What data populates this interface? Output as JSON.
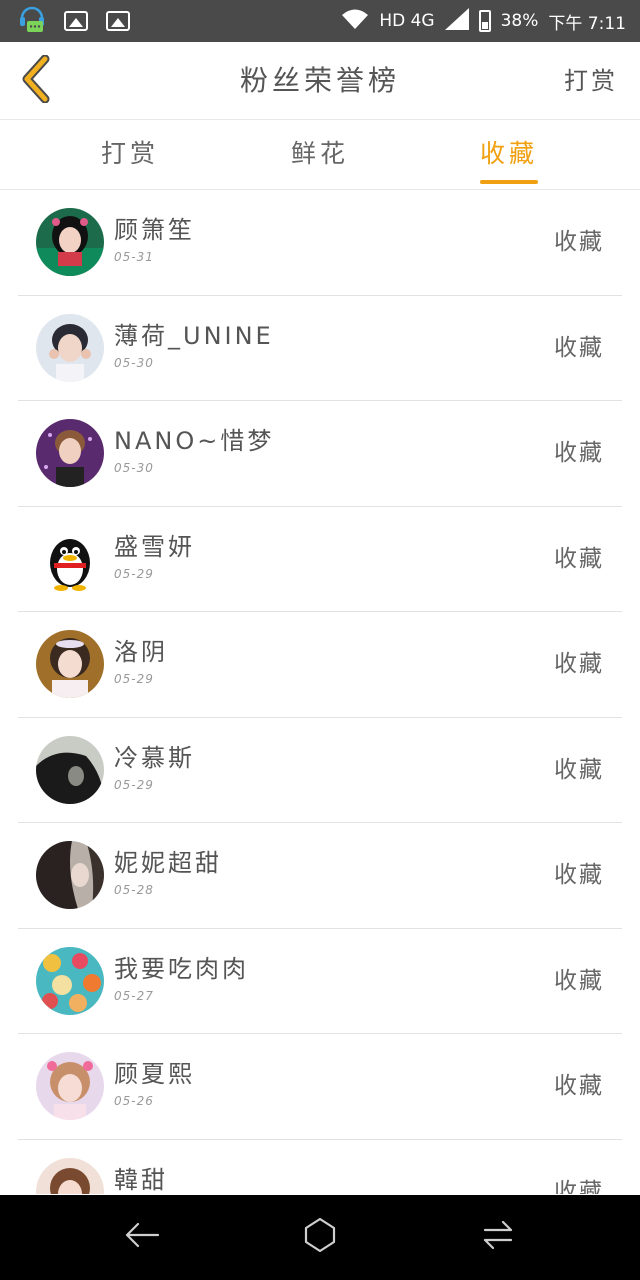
{
  "status_bar": {
    "network": "HD 4G",
    "battery": "38%",
    "time": "下午 7:11",
    "icons": [
      "headset-chat-icon",
      "image-icon",
      "image-icon",
      "wifi-icon",
      "signal-icon",
      "battery-icon"
    ]
  },
  "header": {
    "title": "粉丝荣誉榜",
    "action_label": "打赏",
    "back_icon": "chevron-left-icon"
  },
  "tabs": [
    {
      "label": "打赏",
      "active": false
    },
    {
      "label": "鲜花",
      "active": false
    },
    {
      "label": "收藏",
      "active": true
    }
  ],
  "colors": {
    "accent": "#f0a010",
    "back_icon": "#f0b020",
    "text": "#555555",
    "divider": "#e2e2e2",
    "status_bar": "#4a4a4a",
    "nav_bar": "#000000"
  },
  "list": [
    {
      "name": "顾箫笙",
      "date": "05-31",
      "action": "收藏"
    },
    {
      "name": "薄荷_UNINE",
      "date": "05-30",
      "action": "收藏"
    },
    {
      "name": "NANO~惜梦",
      "date": "05-30",
      "action": "收藏"
    },
    {
      "name": "盛雪妍",
      "date": "05-29",
      "action": "收藏"
    },
    {
      "name": "洛阴",
      "date": "05-29",
      "action": "收藏"
    },
    {
      "name": "冷慕斯",
      "date": "05-29",
      "action": "收藏"
    },
    {
      "name": "妮妮超甜",
      "date": "05-28",
      "action": "收藏"
    },
    {
      "name": "我要吃肉肉",
      "date": "05-27",
      "action": "收藏"
    },
    {
      "name": "顾夏熙",
      "date": "05-26",
      "action": "收藏"
    },
    {
      "name": "韓甜",
      "date": "",
      "action": "收藏"
    }
  ],
  "nav_bar": {
    "icons": [
      "back-arrow-icon",
      "home-icon",
      "recent-apps-icon"
    ]
  }
}
